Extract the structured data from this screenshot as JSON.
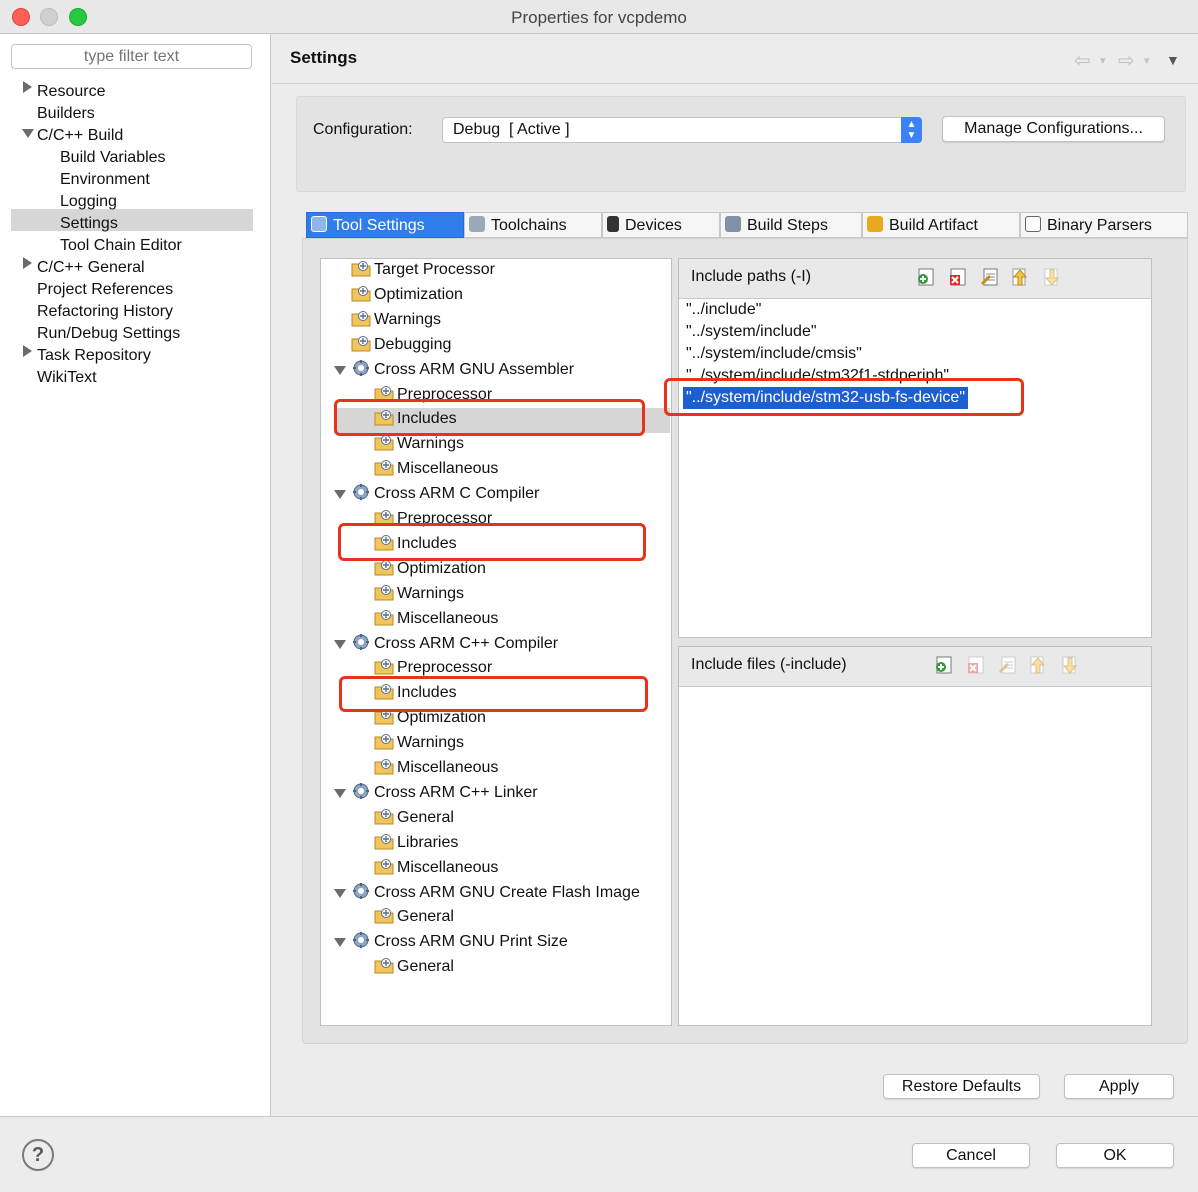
{
  "window": {
    "title": "Properties for vcpdemo"
  },
  "sidebar": {
    "filter_placeholder": "type filter text",
    "items": [
      {
        "label": "Resource"
      },
      {
        "label": "Builders"
      },
      {
        "label": "C/C++ Build"
      },
      {
        "label": "Build Variables"
      },
      {
        "label": "Environment"
      },
      {
        "label": "Logging"
      },
      {
        "label": "Settings"
      },
      {
        "label": "Tool Chain Editor"
      },
      {
        "label": "C/C++ General"
      },
      {
        "label": "Project References"
      },
      {
        "label": "Refactoring History"
      },
      {
        "label": "Run/Debug Settings"
      },
      {
        "label": "Task Repository"
      },
      {
        "label": "WikiText"
      }
    ],
    "selected": "Settings"
  },
  "header": {
    "title": "Settings"
  },
  "configuration": {
    "label": "Configuration:",
    "value": "Debug  [ Active ]",
    "manage_button": "Manage Configurations..."
  },
  "tabs": [
    {
      "label": "Tool Settings"
    },
    {
      "label": "Toolchains"
    },
    {
      "label": "Devices"
    },
    {
      "label": "Build Steps"
    },
    {
      "label": "Build Artifact"
    },
    {
      "label": "Binary Parsers"
    }
  ],
  "tree": [
    {
      "label": "Target Processor"
    },
    {
      "label": "Optimization"
    },
    {
      "label": "Warnings"
    },
    {
      "label": "Debugging"
    },
    {
      "label": "Cross ARM GNU Assembler"
    },
    {
      "label": "Preprocessor"
    },
    {
      "label": "Includes"
    },
    {
      "label": "Warnings"
    },
    {
      "label": "Miscellaneous"
    },
    {
      "label": "Cross ARM C Compiler"
    },
    {
      "label": "Preprocessor"
    },
    {
      "label": "Includes"
    },
    {
      "label": "Optimization"
    },
    {
      "label": "Warnings"
    },
    {
      "label": "Miscellaneous"
    },
    {
      "label": "Cross ARM C++ Compiler"
    },
    {
      "label": "Preprocessor"
    },
    {
      "label": "Includes"
    },
    {
      "label": "Optimization"
    },
    {
      "label": "Warnings"
    },
    {
      "label": "Miscellaneous"
    },
    {
      "label": "Cross ARM C++ Linker"
    },
    {
      "label": "General"
    },
    {
      "label": "Libraries"
    },
    {
      "label": "Miscellaneous"
    },
    {
      "label": "Cross ARM GNU Create Flash Image"
    },
    {
      "label": "General"
    },
    {
      "label": "Cross ARM GNU Print Size"
    },
    {
      "label": "General"
    }
  ],
  "include_paths": {
    "title": "Include paths (-I)",
    "items": [
      "\"../include\"",
      "\"../system/include\"",
      "\"../system/include/cmsis\"",
      "\"../system/include/stm32f1-stdperiph\"",
      "\"../system/include/stm32-usb-fs-device\""
    ],
    "selected": "\"../system/include/stm32-usb-fs-device\""
  },
  "include_files": {
    "title": "Include files (-include)"
  },
  "buttons": {
    "restore_defaults": "Restore Defaults",
    "apply": "Apply",
    "cancel": "Cancel",
    "ok": "OK",
    "help": "?"
  },
  "colors": {
    "accent": "#2f7dea",
    "selection": "#1d5fd1",
    "annotation_red": "#e8321e"
  }
}
